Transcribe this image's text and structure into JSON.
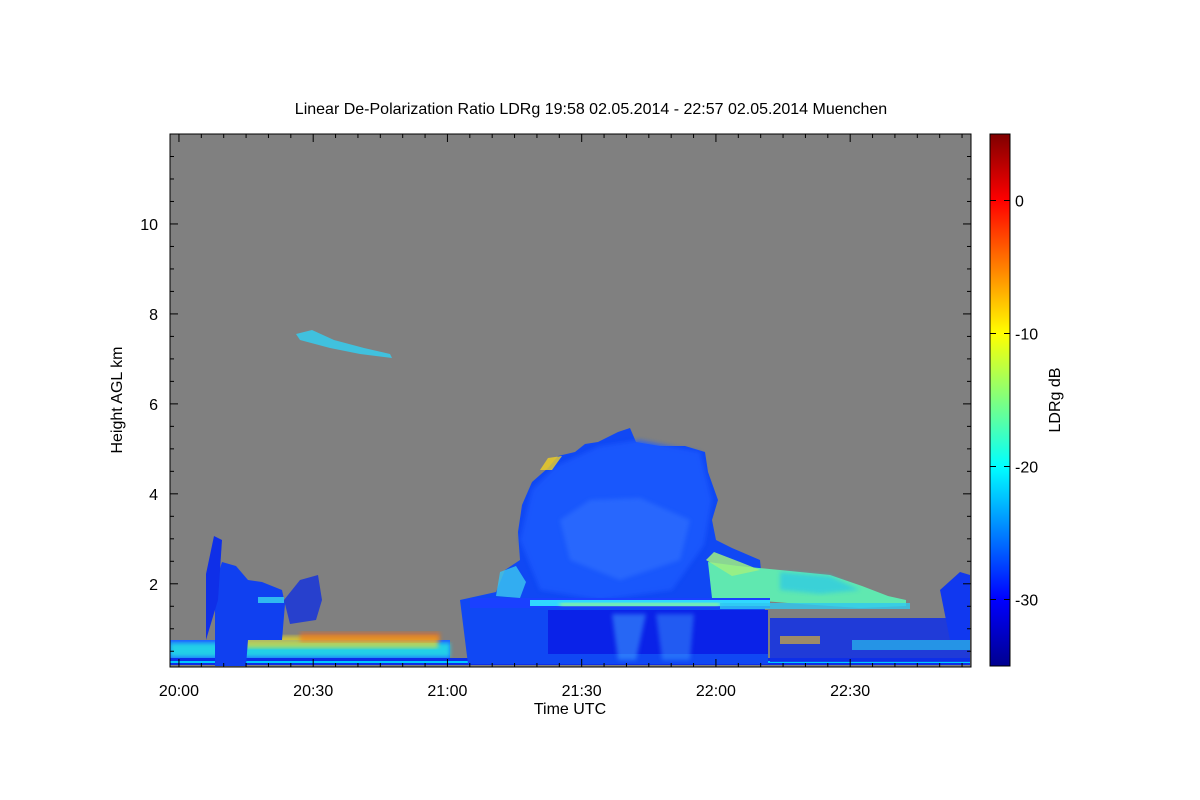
{
  "chart_data": {
    "type": "heatmap",
    "title": "Linear De-Polarization Ratio LDRg   19:58 02.05.2014 - 22:57 02.05.2014 Muenchen",
    "xlabel": "Time UTC",
    "ylabel": "Height AGL km",
    "x_ticks": [
      "20:00",
      "20:30",
      "21:00",
      "21:30",
      "22:00",
      "22:30"
    ],
    "x_tick_minutes": [
      0,
      30,
      60,
      90,
      120,
      150
    ],
    "xlim_minutes": [
      -2,
      177
    ],
    "y_ticks": [
      2,
      4,
      6,
      8,
      10
    ],
    "ylim": [
      0.15,
      12
    ],
    "colorbar": {
      "label": "LDRg dB",
      "ticks": [
        0,
        -10,
        -20,
        -30
      ],
      "range": [
        -35,
        5
      ],
      "colormap": "jet"
    },
    "background_color": "#808080",
    "features": [
      {
        "name": "convective cloud",
        "t_range": [
          81,
          121
        ],
        "z_range": [
          0.3,
          5.4
        ],
        "ldr": -30
      },
      {
        "name": "melting layer bright band",
        "t_range": [
          64,
          167
        ],
        "z_range": [
          1.5,
          1.7
        ],
        "ldr": -22
      },
      {
        "name": "anvil / stratiform layer",
        "t_range": [
          119,
          160
        ],
        "z_range": [
          1.6,
          2.5
        ],
        "ldr": -19
      },
      {
        "name": "early precipitation column",
        "t_range": [
          10,
          26
        ],
        "z_range": [
          0.3,
          2.3
        ],
        "ldr": -30
      },
      {
        "name": "boundary layer aerosol",
        "t_range": [
          0,
          62
        ],
        "z_range": [
          0.25,
          1.0
        ],
        "ldr": -13
      },
      {
        "name": "high cirrus streak",
        "t_range": [
          26,
          49
        ],
        "z_range": [
          7.0,
          7.6
        ],
        "ldr": -22
      }
    ]
  }
}
